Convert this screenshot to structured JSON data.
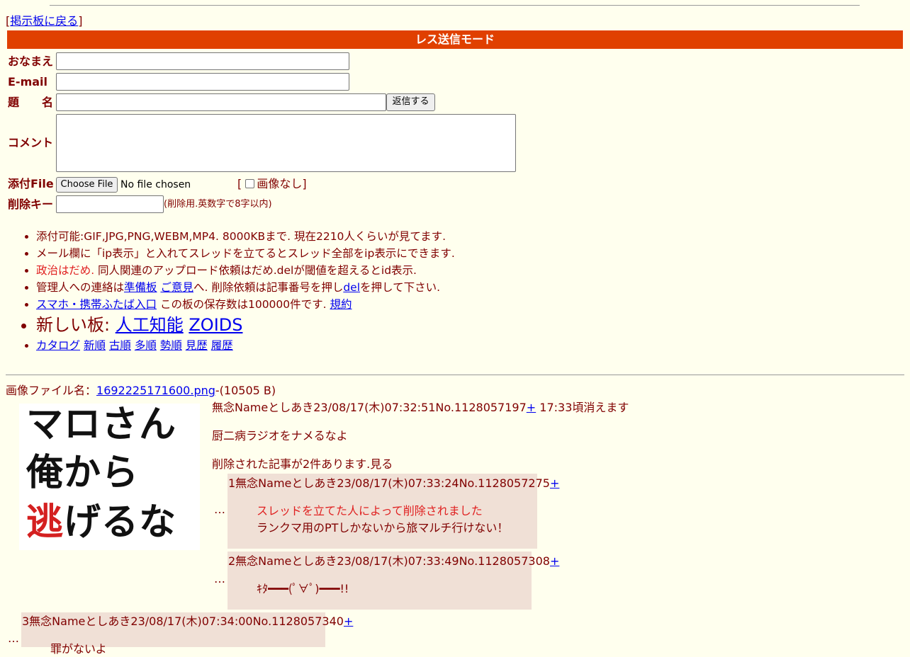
{
  "nav": {
    "back_open": "[",
    "back_link": "掲示板に戻る",
    "back_close": "]"
  },
  "form": {
    "mode_title": "レス送信モード",
    "name_label": "おなまえ",
    "email_label": "E-mail",
    "subject_label": "題　　名",
    "comment_label": "コメント",
    "file_label": "添付File",
    "delkey_label": "削除キー",
    "submit_label": "返信する",
    "choose_file_label": "Choose File",
    "no_file_text": "No file chosen",
    "noimage_open": "[",
    "noimage_label": "画像なし",
    "noimage_close": "]",
    "noimage_checked": false,
    "delkey_note": "(削除用.英数字で8字以内)",
    "name_value": "",
    "email_value": "",
    "subject_value": "",
    "comment_value": "",
    "delkey_value": ""
  },
  "rules": {
    "r1": "添付可能:GIF,JPG,PNG,WEBM,MP4. 8000KBまで. 現在2210人くらいが見てます.",
    "r2": "メール欄に「ip表示」と入れてスレッドを立てるとスレッド全部をip表示にできます.",
    "r3_red": "政治はだめ.",
    "r3_rest": " 同人関連のアップロード依頼はだめ.delが閾値を超えるとid表示.",
    "r4_a": "管理人への連絡は",
    "r4_link1": "準備板",
    "r4_link2": "ご意見",
    "r4_b": "へ. 削除依頼は記事番号を押し",
    "r4_link3": "del",
    "r4_c": "を押して下さい.",
    "r5_link": "スマホ・携帯ふたば入口",
    "r5_rest": " この板の保存数は100000件です. ",
    "r5_link2": "規約",
    "r6_label": "新しい板: ",
    "r6_link1": "人工知能",
    "r6_link2": "ZOIDS",
    "sort_links": [
      "カタログ",
      "新順",
      "古順",
      "多順",
      "勢順",
      "見歴",
      "履歴"
    ]
  },
  "thread": {
    "file_label": "画像ファイル名：",
    "file_name": "1692225171600.png",
    "file_size": "-(10505 B)",
    "thumb_lines": [
      "マロさん",
      "俺から",
      "逃",
      "げるな"
    ],
    "header": "無念Nameとしあき23/08/17(木)07:32:51No.1128057197",
    "plus": "+",
    "expire": " 17:33頃消えます",
    "body": "厨二病ラジオをナメるなよ",
    "deleted_notice": "削除された記事が2件あります.見る",
    "replies": [
      {
        "header": "1無念Nameとしあき23/08/17(木)07:33:24No.1128057275",
        "plus": "+",
        "del_line": "スレッドを立てた人によって削除されました",
        "body": "ランクマ用のPTしかないから旅マルチ行けない！"
      },
      {
        "header": "2無念Nameとしあき23/08/17(木)07:33:49No.1128057308",
        "plus": "+",
        "body": "ｷﾀ━━━(ﾟ∀ﾟ)━━━!!"
      },
      {
        "header": "3無念Nameとしあき23/08/17(木)07:34:00No.1128057340",
        "plus": "+",
        "body": "罪がないよ"
      }
    ],
    "ellipsis": "…"
  },
  "colors": {
    "mode_bar": "#e04000",
    "reply_bg": "#f0e0d6",
    "text": "#800000",
    "link": "#0000ee",
    "thumb_red": "#d42020"
  }
}
